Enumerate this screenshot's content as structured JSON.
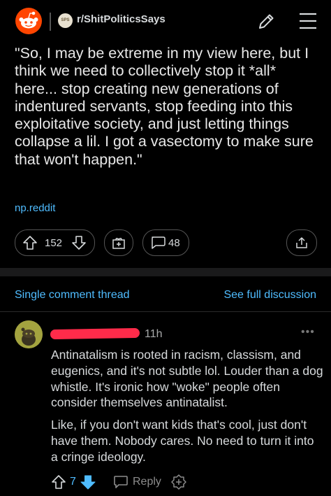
{
  "header": {
    "subreddit_badge": "SPS",
    "subreddit_name": "r/ShitPoliticsSays",
    "icons": [
      "reddit-logo-icon",
      "pencil-icon",
      "menu-icon"
    ]
  },
  "post": {
    "text": "\"So, I may be extreme in my view here, but I think we need to collectively stop it *all* here... stop creating new generations of indentured servants, stop feeding into this exploitative society, and just letting things collapse a lil. I got a vasectomy to make sure that won't happen.\"",
    "link": "np.reddit",
    "vote_count": "152",
    "comment_count": "48"
  },
  "thread": {
    "single_label": "Single comment thread",
    "full_label": "See full discussion"
  },
  "comment": {
    "time": "11h",
    "paragraph1": "Antinatalism is rooted in racism, classism, and eugenics, and it's not subtle lol. Louder than a dog whistle. It's ironic how \"woke\" people often consider themselves antinatalist.",
    "paragraph2": "Like, if you don't want kids that's cool, just don't have them. Nobody cares. No need to turn it into a cringe ideology.",
    "score": "7",
    "reply_label": "Reply"
  },
  "colors": {
    "accent_blue": "#4fbcff",
    "reddit_orange": "#ff4500",
    "redaction": "#ff2b4a",
    "background": "#000000"
  }
}
